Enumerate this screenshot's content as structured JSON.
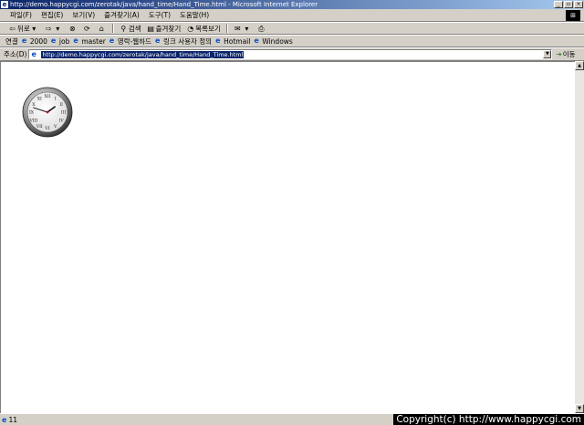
{
  "window": {
    "title": "http://demo.happycgi.com/zerotak/java/hand_time/Hand_Time.html - Microsoft Internet Explorer",
    "minimize": "_",
    "restore": "▫",
    "close": "×"
  },
  "menubar": {
    "items": [
      "파일(F)",
      "편집(E)",
      "보기(V)",
      "즐겨찾기(A)",
      "도구(T)",
      "도움말(H)"
    ]
  },
  "toolbar": {
    "back": "뒤로",
    "search": "검색",
    "favorites": "즐겨찾기",
    "history": "목록보기"
  },
  "links": {
    "label": "연결",
    "items": [
      "2000",
      "job",
      "master",
      "영락-웹하드",
      "링크 사용자 정의",
      "Hotmail",
      "Windows"
    ]
  },
  "address": {
    "label": "주소(D)",
    "url": "http://demo.happycgi.com/zerotak/java/hand_time/Hand_Time.html",
    "go": "이동"
  },
  "clock": {
    "hour": 1,
    "minute": 48,
    "numerals": [
      "XII",
      "I",
      "II",
      "III",
      "IV",
      "V",
      "VI",
      "VII",
      "VIII",
      "IX",
      "X",
      "XI"
    ]
  },
  "status": {
    "text": "11"
  },
  "watermark": "Copyright(c) http://www.happycgi.com"
}
